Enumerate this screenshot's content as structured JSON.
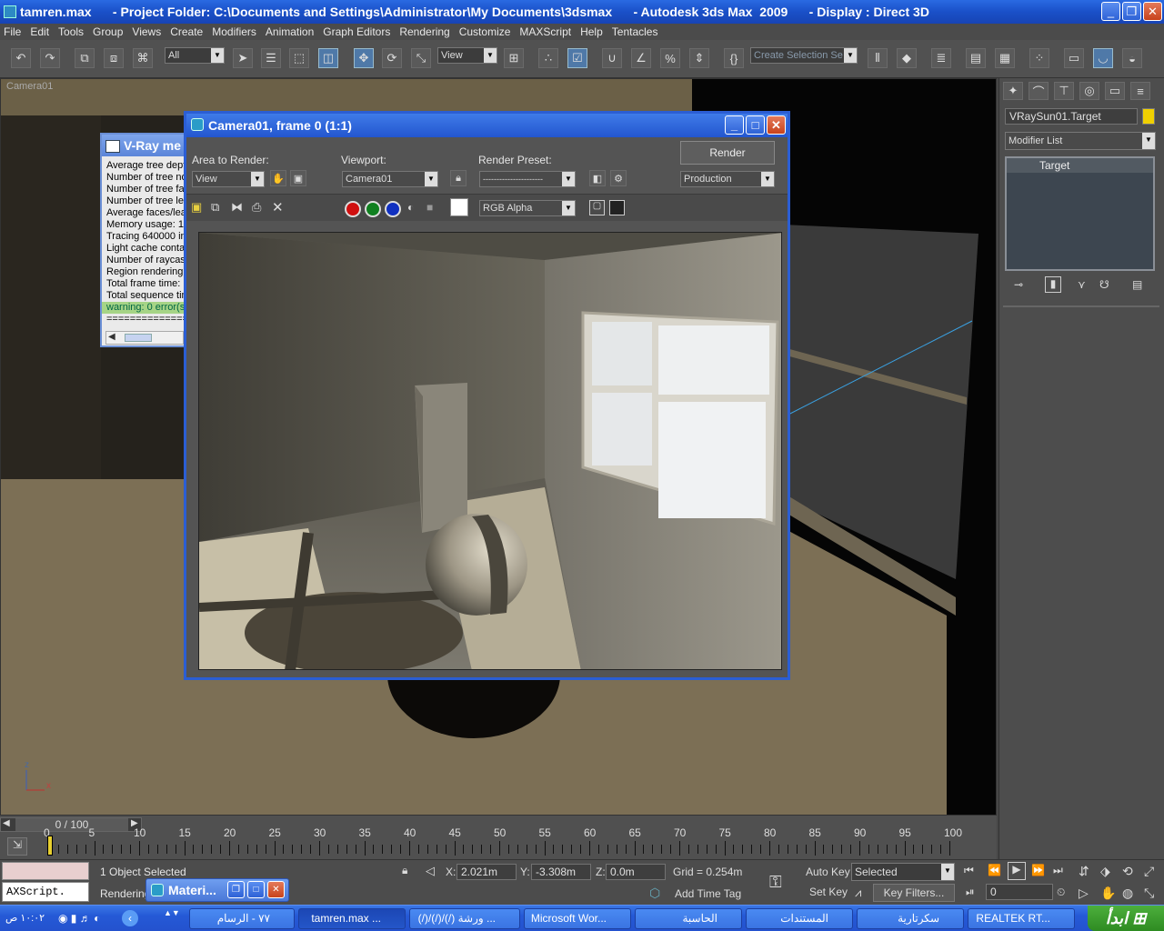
{
  "window": {
    "title": "tamren.max      - Project Folder: C:\\Documents and Settings\\Administrator\\My Documents\\3dsmax      - Autodesk 3ds Max  2009      - Display : Direct 3D"
  },
  "menu": [
    "File",
    "Edit",
    "Tools",
    "Group",
    "Views",
    "Create",
    "Modifiers",
    "Animation",
    "Graph Editors",
    "Rendering",
    "Customize",
    "MAXScript",
    "Help",
    "Tentacles"
  ],
  "toolbar": {
    "filter_value": "All",
    "refcoord_value": "View",
    "selection_set_placeholder": "Create Selection Se"
  },
  "viewport": {
    "label": "Camera01"
  },
  "vray_log": {
    "title": "V-Ray me",
    "lines": [
      "Average tree dept",
      "Number of tree no",
      "Number of tree fac",
      "Number of tree lea",
      "Average faces/lea",
      "Memory usage: 1.",
      "Tracing 640000 in",
      "Light cache conta",
      "Number of raycast",
      "Region rendering:",
      "Total frame time: 1",
      "Total sequence tim",
      "warning: 0 error(s),",
      "=============="
    ]
  },
  "render_window": {
    "title": "Camera01, frame 0 (1:1)",
    "area_label": "Area to Render:",
    "area_value": "View",
    "viewport_label": "Viewport:",
    "viewport_value": "Camera01",
    "preset_label": "Render Preset:",
    "preset_value": "----------------------",
    "render_button": "Render",
    "production_value": "Production",
    "channel_value": "RGB Alpha"
  },
  "command_panel": {
    "object_name": "VRaySun01.Target",
    "modifier_list": "Modifier List",
    "stack_item": "Target",
    "object_color": "#f0d000"
  },
  "timeline": {
    "frame_label": "0 / 100",
    "ticks": [
      "0",
      "5",
      "10",
      "15",
      "20",
      "25",
      "30",
      "35",
      "40",
      "45",
      "50",
      "55",
      "60",
      "65",
      "70",
      "75",
      "80",
      "85",
      "90",
      "95",
      "100"
    ]
  },
  "status": {
    "selection_text": "1 Object Selected",
    "prompt_text": "Rendering",
    "maxscript_listener": "AXScript.",
    "x_label": "X:",
    "x_value": "2.021m",
    "y_label": "Y:",
    "y_value": "-3.308m",
    "z_label": "Z:",
    "z_value": "0.0m",
    "grid": "Grid = 0.254m",
    "add_time_tag": "Add Time Tag",
    "auto_key": "Auto Key",
    "set_key": "Set Key",
    "key_mode_value": "Selected",
    "key_filters": "Key Filters...",
    "current_frame": "0"
  },
  "material_editor_min": {
    "title": "Materi..."
  },
  "taskbar": {
    "items": [
      "REALTEK RT...",
      "سكرتارية",
      "المستندات",
      "الحاسبة",
      "Microsoft Wor...",
      "(/)/(/)/(/) ورشة ...",
      "tamren.max ...",
      "٧٧ - الرسام"
    ],
    "clock": "١٠:٠٢ ص",
    "start_label": "ابدأ"
  }
}
